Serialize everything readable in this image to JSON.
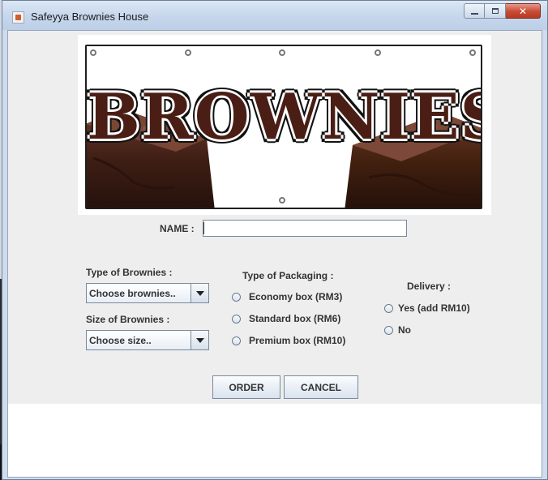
{
  "window": {
    "title": "Safeyya Brownies House"
  },
  "banner": {
    "text": "BROWNIES"
  },
  "form": {
    "name_label": "NAME :",
    "name_value": "",
    "brownie_type_label": "Type of Brownies :",
    "brownie_type_selected": "Choose brownies..",
    "brownie_size_label": "Size of Brownies :",
    "brownie_size_selected": "Choose size..",
    "packaging_label": "Type of Packaging :",
    "packaging_options": [
      "Economy box (RM3)",
      "Standard box (RM6)",
      "Premium box (RM10)"
    ],
    "delivery_label": "Delivery :",
    "delivery_options": [
      "Yes (add RM10)",
      "No"
    ]
  },
  "buttons": {
    "order": "ORDER",
    "cancel": "CANCEL"
  },
  "colors": {
    "panel_bg": "#eeeeee",
    "banner_text": "#4a1e14",
    "close_button": "#c74a33"
  }
}
